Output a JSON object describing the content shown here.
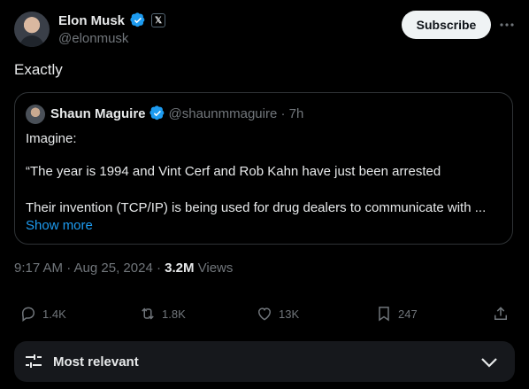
{
  "author": {
    "name": "Elon Musk",
    "handle": "@elonmusk",
    "badge": "𝕏"
  },
  "subscribe_label": "Subscribe",
  "tweet": {
    "text": "Exactly"
  },
  "quote": {
    "name": "Shaun Maguire",
    "handle_time": "@shaunmmaguire · 7h",
    "lines": [
      "Imagine:",
      "“The year is 1994 and Vint Cerf and Rob Kahn have just been arrested",
      "Their invention (TCP/IP) is being used for drug dealers to communicate with ..."
    ],
    "show_more": "Show more"
  },
  "meta": {
    "datetime": "9:17 AM · Aug 25, 2024 · ",
    "views_count": "3.2M",
    "views_label": " Views"
  },
  "actions": {
    "replies": "1.4K",
    "reposts": "1.8K",
    "likes": "13K",
    "bookmarks": "247"
  },
  "sort": {
    "label": "Most relevant"
  },
  "colors": {
    "accent": "#1d9bf0",
    "background": "#000000",
    "muted": "#71767b"
  }
}
